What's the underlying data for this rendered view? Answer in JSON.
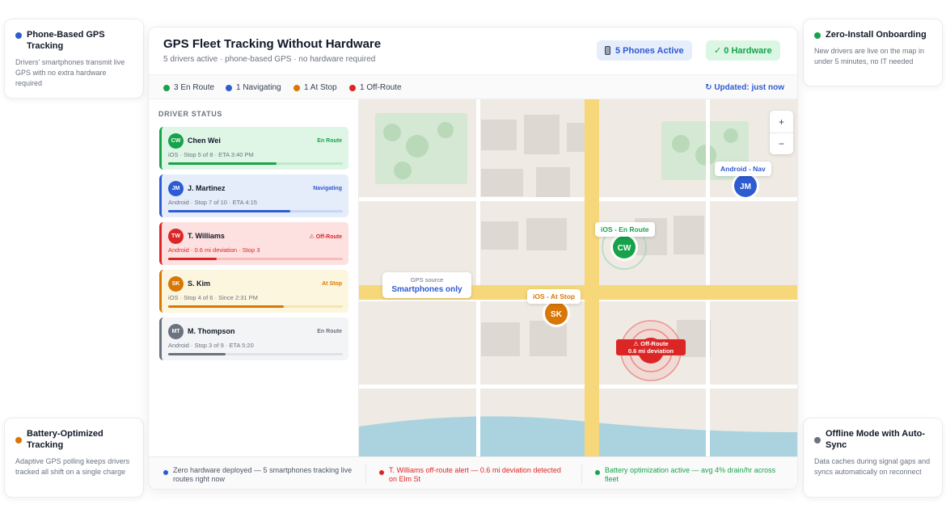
{
  "features": [
    {
      "title": "Phone-Based GPS Tracking",
      "desc": "Drivers' smartphones transmit live GPS with no extra hardware required",
      "color": "#2d5bd1"
    },
    {
      "title": "Zero-Install Onboarding",
      "desc": "New drivers are live on the map in under 5 minutes, no IT needed",
      "color": "#16a34a"
    },
    {
      "title": "Battery-Optimized Tracking",
      "desc": "Adaptive GPS polling keeps drivers tracked all shift on a single charge",
      "color": "#d97706"
    },
    {
      "title": "Offline Mode with Auto-Sync",
      "desc": "Data caches during signal gaps and syncs automatically on reconnect",
      "color": "#6b7280"
    }
  ],
  "header": {
    "title": "GPS Fleet Tracking Without Hardware",
    "subtitle": "5 drivers active · phone-based GPS · no hardware required",
    "phones_pill": "5 Phones Active",
    "hardware_pill": "✓ 0 Hardware"
  },
  "statusbar": {
    "items": [
      {
        "label": "3 En Route",
        "color": "#16a34a"
      },
      {
        "label": "1 Navigating",
        "color": "#2d5bd1"
      },
      {
        "label": "1 At Stop",
        "color": "#d97706"
      },
      {
        "label": "1 Off-Route",
        "color": "#dc2626"
      }
    ],
    "updated": "↻ Updated: just now"
  },
  "sidebar": {
    "title": "DRIVER STATUS",
    "drivers": [
      {
        "initials": "CW",
        "name": "Chen Wei",
        "status": "En Route",
        "meta": "iOS · Stop 5 of 8 · ETA 3:40 PM",
        "progress": 0.62,
        "accent": "#16a34a",
        "bg": "#dff6e6",
        "track": "#bfe9cc",
        "meta_color": "#6b7280"
      },
      {
        "initials": "JM",
        "name": "J. Martinez",
        "status": "Navigating",
        "meta": "Android · Stop 7 of 10 · ETA 4:15",
        "progress": 0.7,
        "accent": "#2d5bd1",
        "bg": "#e5edfb",
        "track": "#c7d6f5",
        "meta_color": "#6b7280"
      },
      {
        "initials": "TW",
        "name": "T. Williams",
        "status": "⚠ Off-Route",
        "meta": "Android · 0.6 mi deviation · Stop 3",
        "progress": 0.28,
        "accent": "#dc2626",
        "bg": "#fde0e0",
        "track": "#f6bcbc",
        "meta_color": "#dc2626"
      },
      {
        "initials": "SK",
        "name": "S. Kim",
        "status": "At Stop",
        "meta": "iOS · Stop 4 of 6 · Since 2:31 PM",
        "progress": 0.66,
        "accent": "#d97706",
        "bg": "#fdf6de",
        "track": "#f6e4b0",
        "meta_color": "#6b7280"
      },
      {
        "initials": "MT",
        "name": "M. Thompson",
        "status": "En Route",
        "meta": "Android · Stop 3 of 9 · ETA 5:20",
        "progress": 0.33,
        "accent": "#6b7280",
        "bg": "#f3f4f6",
        "track": "#e0e2e6",
        "meta_color": "#6b7280"
      }
    ]
  },
  "map": {
    "zoom_in": "+",
    "zoom_out": "−",
    "gps_source_label": "GPS source",
    "gps_source_value": "Smartphones only",
    "markers": [
      {
        "initials": "JM",
        "label": "Android - Nav",
        "color": "#2d5bd1"
      },
      {
        "initials": "CW",
        "label": "iOS - En Route",
        "color": "#16a34a"
      },
      {
        "initials": "SK",
        "label": "iOS - At Stop",
        "color": "#d97706"
      }
    ],
    "offroute_line1": "⚠ Off-Route",
    "offroute_line2": "0.6 mi deviation"
  },
  "footer": {
    "items": [
      {
        "text": "Zero hardware deployed — 5 smartphones tracking live routes right now",
        "color": "#2d5bd1",
        "text_color": "#4b5563"
      },
      {
        "text": "T. Williams off-route alert — 0.6 mi deviation detected on Elm St",
        "color": "#dc2626",
        "text_color": "#dc2626"
      },
      {
        "text": "Battery optimization active — avg 4% drain/hr across fleet",
        "color": "#16a34a",
        "text_color": "#16a34a"
      }
    ]
  }
}
